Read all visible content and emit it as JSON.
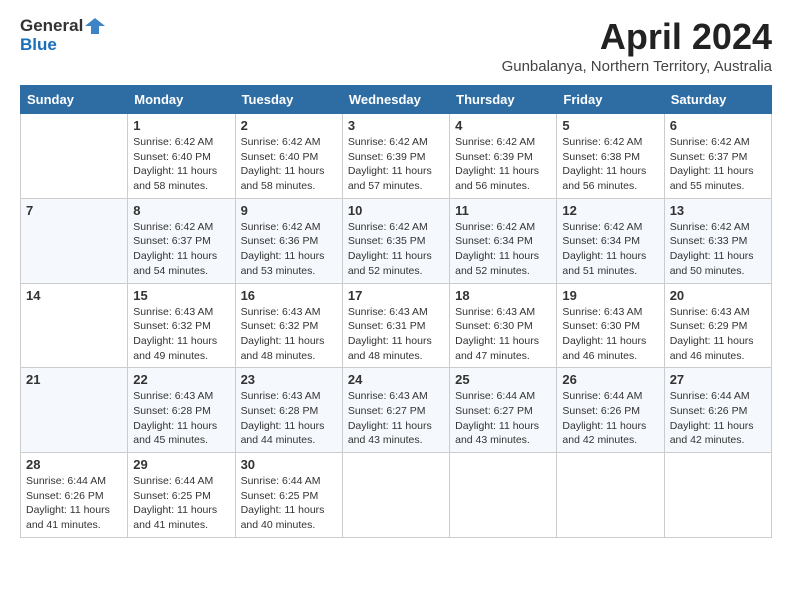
{
  "logo": {
    "general": "General",
    "blue": "Blue"
  },
  "title": "April 2024",
  "subtitle": "Gunbalanya, Northern Territory, Australia",
  "days_of_week": [
    "Sunday",
    "Monday",
    "Tuesday",
    "Wednesday",
    "Thursday",
    "Friday",
    "Saturday"
  ],
  "weeks": [
    [
      {
        "day": "",
        "info": ""
      },
      {
        "day": "1",
        "info": "Sunrise: 6:42 AM\nSunset: 6:40 PM\nDaylight: 11 hours\nand 58 minutes."
      },
      {
        "day": "2",
        "info": "Sunrise: 6:42 AM\nSunset: 6:40 PM\nDaylight: 11 hours\nand 58 minutes."
      },
      {
        "day": "3",
        "info": "Sunrise: 6:42 AM\nSunset: 6:39 PM\nDaylight: 11 hours\nand 57 minutes."
      },
      {
        "day": "4",
        "info": "Sunrise: 6:42 AM\nSunset: 6:39 PM\nDaylight: 11 hours\nand 56 minutes."
      },
      {
        "day": "5",
        "info": "Sunrise: 6:42 AM\nSunset: 6:38 PM\nDaylight: 11 hours\nand 56 minutes."
      },
      {
        "day": "6",
        "info": "Sunrise: 6:42 AM\nSunset: 6:37 PM\nDaylight: 11 hours\nand 55 minutes."
      }
    ],
    [
      {
        "day": "7",
        "info": ""
      },
      {
        "day": "8",
        "info": "Sunrise: 6:42 AM\nSunset: 6:37 PM\nDaylight: 11 hours\nand 54 minutes."
      },
      {
        "day": "9",
        "info": "Sunrise: 6:42 AM\nSunset: 6:36 PM\nDaylight: 11 hours\nand 53 minutes."
      },
      {
        "day": "10",
        "info": "Sunrise: 6:42 AM\nSunset: 6:35 PM\nDaylight: 11 hours\nand 52 minutes."
      },
      {
        "day": "11",
        "info": "Sunrise: 6:42 AM\nSunset: 6:34 PM\nDaylight: 11 hours\nand 52 minutes."
      },
      {
        "day": "12",
        "info": "Sunrise: 6:42 AM\nSunset: 6:34 PM\nDaylight: 11 hours\nand 51 minutes."
      },
      {
        "day": "13",
        "info": "Sunrise: 6:42 AM\nSunset: 6:33 PM\nDaylight: 11 hours\nand 50 minutes."
      }
    ],
    [
      {
        "day": "14",
        "info": ""
      },
      {
        "day": "15",
        "info": "Sunrise: 6:43 AM\nSunset: 6:32 PM\nDaylight: 11 hours\nand 49 minutes."
      },
      {
        "day": "16",
        "info": "Sunrise: 6:43 AM\nSunset: 6:32 PM\nDaylight: 11 hours\nand 48 minutes."
      },
      {
        "day": "17",
        "info": "Sunrise: 6:43 AM\nSunset: 6:31 PM\nDaylight: 11 hours\nand 48 minutes."
      },
      {
        "day": "18",
        "info": "Sunrise: 6:43 AM\nSunset: 6:30 PM\nDaylight: 11 hours\nand 47 minutes."
      },
      {
        "day": "19",
        "info": "Sunrise: 6:43 AM\nSunset: 6:30 PM\nDaylight: 11 hours\nand 46 minutes."
      },
      {
        "day": "20",
        "info": "Sunrise: 6:43 AM\nSunset: 6:29 PM\nDaylight: 11 hours\nand 46 minutes."
      }
    ],
    [
      {
        "day": "21",
        "info": ""
      },
      {
        "day": "22",
        "info": "Sunrise: 6:43 AM\nSunset: 6:28 PM\nDaylight: 11 hours\nand 45 minutes."
      },
      {
        "day": "23",
        "info": "Sunrise: 6:43 AM\nSunset: 6:28 PM\nDaylight: 11 hours\nand 44 minutes."
      },
      {
        "day": "24",
        "info": "Sunrise: 6:43 AM\nSunset: 6:27 PM\nDaylight: 11 hours\nand 43 minutes."
      },
      {
        "day": "25",
        "info": "Sunrise: 6:44 AM\nSunset: 6:27 PM\nDaylight: 11 hours\nand 43 minutes."
      },
      {
        "day": "26",
        "info": "Sunrise: 6:44 AM\nSunset: 6:26 PM\nDaylight: 11 hours\nand 42 minutes."
      },
      {
        "day": "27",
        "info": "Sunrise: 6:44 AM\nSunset: 6:26 PM\nDaylight: 11 hours\nand 42 minutes."
      }
    ],
    [
      {
        "day": "28",
        "info": "Sunrise: 6:44 AM\nSunset: 6:26 PM\nDaylight: 11 hours\nand 41 minutes."
      },
      {
        "day": "29",
        "info": "Sunrise: 6:44 AM\nSunset: 6:25 PM\nDaylight: 11 hours\nand 41 minutes."
      },
      {
        "day": "30",
        "info": "Sunrise: 6:44 AM\nSunset: 6:25 PM\nDaylight: 11 hours\nand 40 minutes."
      },
      {
        "day": "",
        "info": ""
      },
      {
        "day": "",
        "info": ""
      },
      {
        "day": "",
        "info": ""
      },
      {
        "day": "",
        "info": ""
      }
    ]
  ]
}
